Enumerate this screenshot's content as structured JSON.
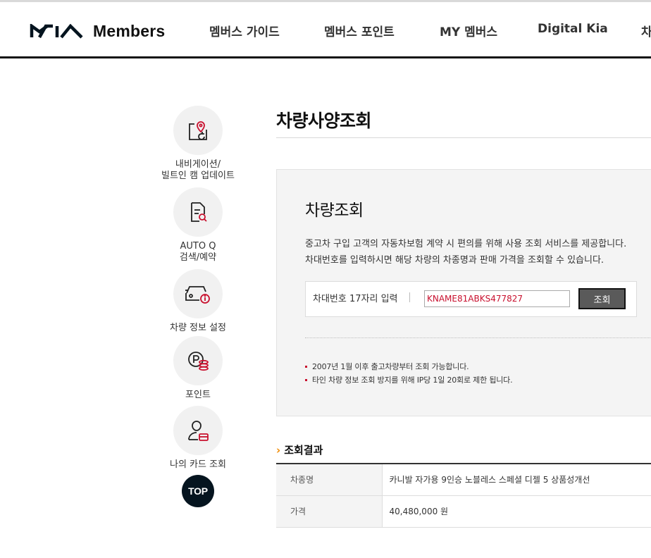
{
  "header": {
    "logo_text": "Members",
    "nav": [
      "멤버스 가이드",
      "멤버스 포인트",
      "MY 멤버스",
      "Digital Kia",
      "차"
    ]
  },
  "quick_menu": {
    "items": [
      {
        "label": "내비게이션/\n빌트인 캠 업데이트",
        "icon": "navigation-update-icon"
      },
      {
        "label": "AUTO Q\n검색/예약",
        "icon": "document-search-icon"
      },
      {
        "label": "차량 정보 설정",
        "icon": "car-info-icon"
      },
      {
        "label": "포인트",
        "icon": "point-coin-icon"
      },
      {
        "label": "나의 카드 조회",
        "icon": "user-card-icon"
      }
    ],
    "top_label": "TOP"
  },
  "page": {
    "title": "차량사양조회"
  },
  "lookup": {
    "title": "차량조회",
    "desc_line1": "중고차 구입 고객의 자동차보험 계약 시 편의를 위해 사용 조회 서비스를 제공합니다.",
    "desc_line2": "차대번호를 입력하시면 해당 차량의 차종명과 판매 가격을 조회할 수 있습니다.",
    "input_label": "차대번호 17자리 입력",
    "vin_value": "KNAME81ABKS477827",
    "search_button": "조회",
    "notes": [
      "2007년 1월 이후 출고차량부터 조회 가능합니다.",
      "타인 차량 정보 조회 방지를 위해 IP당 1일 20회로 제한 됩니다."
    ]
  },
  "result": {
    "title": "조회결과",
    "rows": [
      {
        "label": "차종명",
        "value": "카니발 자가용 9인승 노블레스 스페셜 디젤 5 상품성개선"
      },
      {
        "label": "가격",
        "value": "40,480,000 원"
      }
    ]
  },
  "colors": {
    "brand_dark": "#05141f",
    "accent_red": "#c8102e",
    "accent_orange": "#f08a00",
    "panel_bg": "#f4f4f4"
  }
}
